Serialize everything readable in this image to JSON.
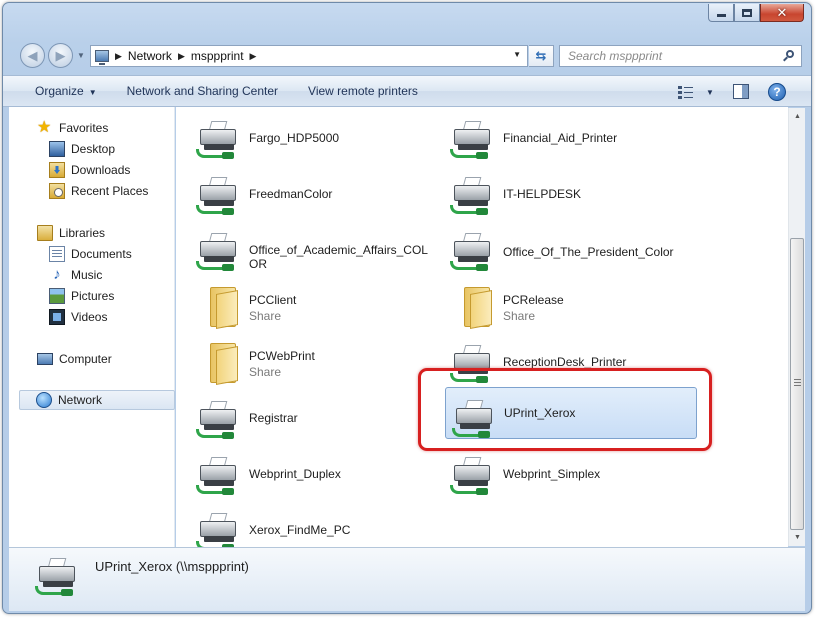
{
  "address": {
    "segments": [
      "Network",
      "msppprint"
    ]
  },
  "search": {
    "placeholder": "Search msppprint"
  },
  "toolbar": {
    "organize": "Organize",
    "network_sharing": "Network and Sharing Center",
    "view_remote": "View remote printers"
  },
  "caption": {
    "close": "✕"
  },
  "nav": {
    "favorites": "Favorites",
    "desktop": "Desktop",
    "downloads": "Downloads",
    "recent": "Recent Places",
    "libraries": "Libraries",
    "documents": "Documents",
    "music": "Music",
    "pictures": "Pictures",
    "videos": "Videos",
    "computer": "Computer",
    "network": "Network"
  },
  "items": [
    {
      "name": "Fargo_HDP5000",
      "type": "printer",
      "sub": ""
    },
    {
      "name": "Financial_Aid_Printer",
      "type": "printer",
      "sub": ""
    },
    {
      "name": "FreedmanColor",
      "type": "printer",
      "sub": ""
    },
    {
      "name": "IT-HELPDESK",
      "type": "printer",
      "sub": ""
    },
    {
      "name": "Office_of_Academic_Affairs_COLOR",
      "type": "printer",
      "sub": ""
    },
    {
      "name": "Office_Of_The_President_Color",
      "type": "printer",
      "sub": ""
    },
    {
      "name": "PCClient",
      "type": "folder",
      "sub": "Share"
    },
    {
      "name": "PCRelease",
      "type": "folder",
      "sub": "Share"
    },
    {
      "name": "PCWebPrint",
      "type": "folder",
      "sub": "Share"
    },
    {
      "name": "ReceptionDesk_Printer",
      "type": "printer",
      "sub": ""
    },
    {
      "name": "Registrar",
      "type": "printer",
      "sub": ""
    },
    {
      "name": "UPrint_Xerox",
      "type": "printer",
      "sub": ""
    },
    {
      "name": "Webprint_Duplex",
      "type": "printer",
      "sub": ""
    },
    {
      "name": "Webprint_Simplex",
      "type": "printer",
      "sub": ""
    },
    {
      "name": "Xerox_FindMe_PC",
      "type": "printer",
      "sub": ""
    }
  ],
  "selected_item": "UPrint_Xerox",
  "details": {
    "text": "UPrint_Xerox (\\\\msppprint)"
  },
  "colors": {
    "highlight": "#d72020",
    "selection": "#c8ddf6",
    "command_text": "#1f3357"
  }
}
